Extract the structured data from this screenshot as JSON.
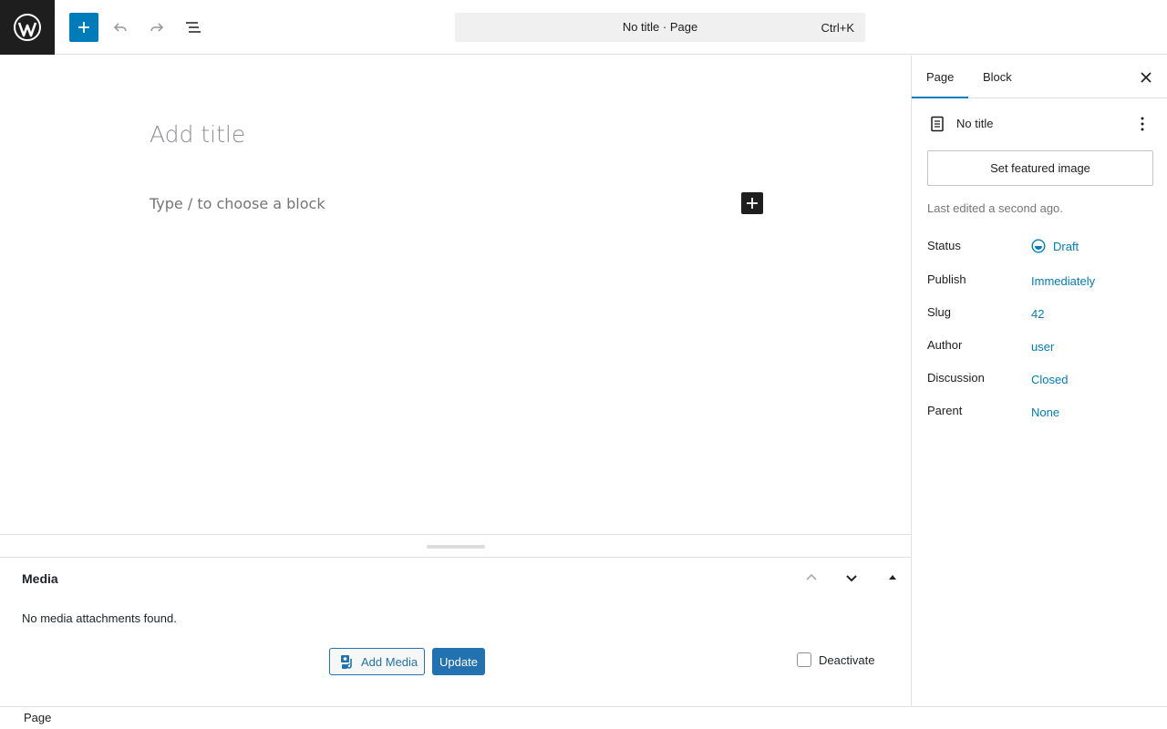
{
  "toolbar": {
    "command_title": "No title · Page",
    "command_shortcut": "Ctrl+K"
  },
  "editor": {
    "title_placeholder": "Add title",
    "block_placeholder": "Type / to choose a block"
  },
  "metabox": {
    "title": "Media",
    "empty_text": "No media attachments found.",
    "add_media_label": "Add Media",
    "update_label": "Update",
    "deactivate_label": "Deactivate"
  },
  "footer": {
    "breadcrumb": "Page"
  },
  "sidebar": {
    "tabs": [
      {
        "label": "Page",
        "active": true
      },
      {
        "label": "Block",
        "active": false
      }
    ],
    "doc_title": "No title",
    "featured_image_label": "Set featured image",
    "last_edited": "Last edited a second ago.",
    "meta": [
      {
        "key": "Status",
        "value": "Draft"
      },
      {
        "key": "Publish",
        "value": "Immediately"
      },
      {
        "key": "Slug",
        "value": "42"
      },
      {
        "key": "Author",
        "value": "user"
      },
      {
        "key": "Discussion",
        "value": "Closed"
      },
      {
        "key": "Parent",
        "value": "None"
      }
    ]
  },
  "colors": {
    "accent": "#007cba",
    "dark": "#1e1e1e",
    "wp_button": "#2271b1"
  }
}
